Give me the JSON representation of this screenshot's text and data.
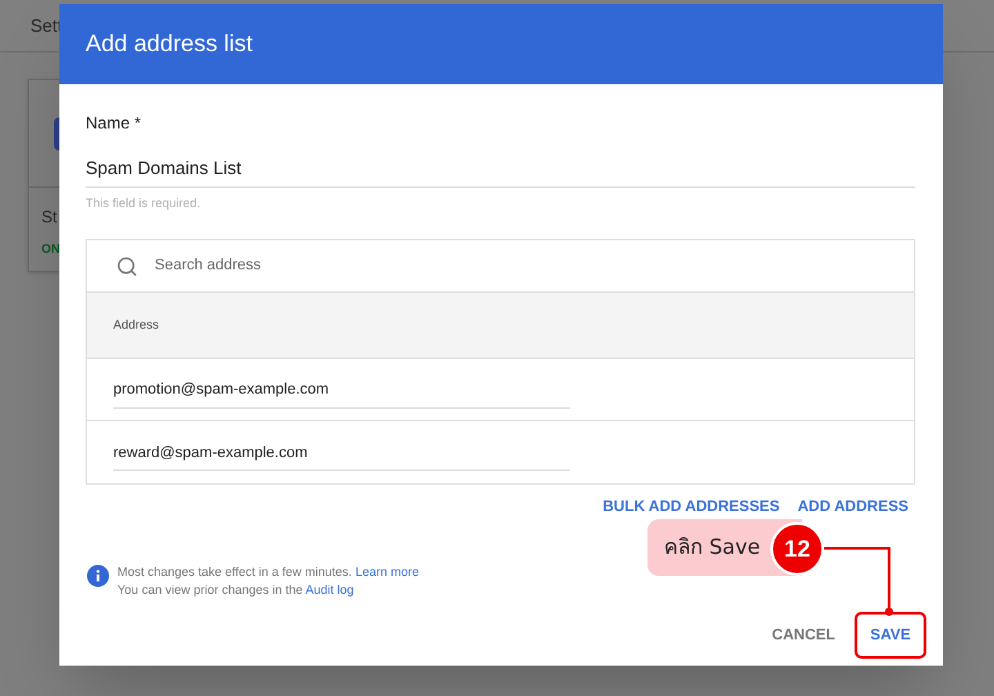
{
  "background": {
    "tab": "Sett",
    "card": {
      "label": "St",
      "status": "ON"
    }
  },
  "dialog": {
    "title": "Add address list",
    "name_field": {
      "label": "Name *",
      "value": "Spam Domains List",
      "helper": "This field is required."
    },
    "search": {
      "placeholder": "Search address"
    },
    "table": {
      "columns": [
        "Address"
      ],
      "rows": [
        "promotion@spam-example.com",
        "reward@spam-example.com"
      ]
    },
    "actions": [
      "BULK ADD ADDRESSES",
      "ADD ADDRESS"
    ],
    "info": {
      "line1": "Most changes take effect in a few minutes.",
      "link1": "Learn more",
      "line2": "You can view prior changes in the",
      "link2": "Audit log"
    },
    "buttons": {
      "cancel": "CANCEL",
      "save": "SAVE"
    }
  },
  "annotation": {
    "text": "คลิก Save",
    "step": "12"
  }
}
